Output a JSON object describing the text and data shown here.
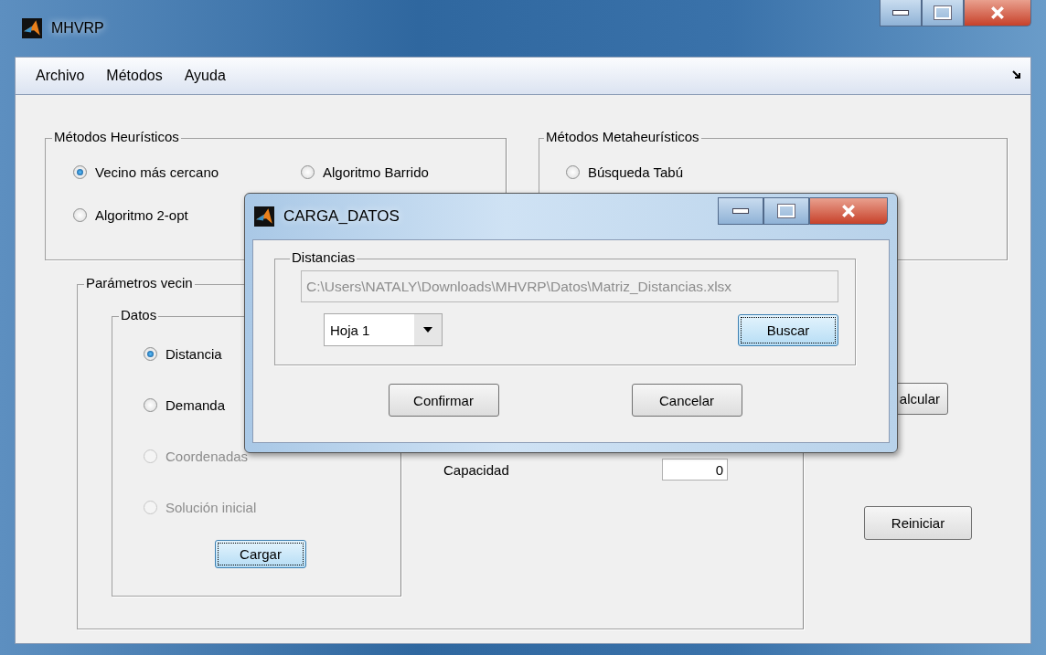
{
  "window": {
    "title": "MHVRP"
  },
  "menu": [
    {
      "label": "Archivo"
    },
    {
      "label": "Métodos"
    },
    {
      "label": "Ayuda"
    }
  ],
  "heuristic_panel": {
    "title": "Métodos Heurísticos",
    "options": [
      {
        "label": "Vecino más cercano",
        "selected": true
      },
      {
        "label": "Algoritmo Barrido",
        "selected": false
      },
      {
        "label": "Algoritmo 2-opt",
        "selected": false
      }
    ]
  },
  "metaheuristic_panel": {
    "title": "Métodos Metaheurísticos",
    "options": [
      {
        "label": "Búsqueda Tabú",
        "selected": false
      }
    ]
  },
  "params_panel": {
    "title": "Parámetros vecin",
    "data_panel": {
      "title": "Datos",
      "options": [
        {
          "label": "Distancia",
          "selected": true,
          "disabled": false
        },
        {
          "label": "Demanda",
          "selected": false,
          "disabled": false
        },
        {
          "label": "Coordenadas",
          "selected": false,
          "disabled": true
        },
        {
          "label": "Solución inicial",
          "selected": false,
          "disabled": true
        }
      ],
      "load_button": "Cargar"
    },
    "capacity": {
      "label": "Capacidad",
      "value": "0"
    }
  },
  "calculate_button": "alcular",
  "reset_button": "Reiniciar",
  "dialog": {
    "title": "CARGA_DATOS",
    "group": {
      "title": "Distancias",
      "path": {
        "value": "C:\\Users\\NATALY\\Downloads\\MHVRP\\Datos\\Matriz_Distancias.xlsx",
        "disabled": true
      },
      "sheet": "Hoja 1",
      "search_button": "Buscar"
    },
    "buttons": [
      "Confirmar",
      "Cancelar"
    ]
  }
}
